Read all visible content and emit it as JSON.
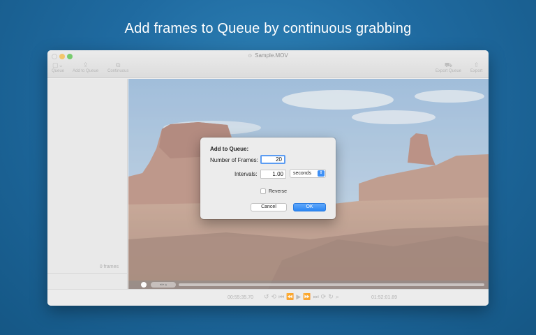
{
  "headline": "Add frames to Queue by continuous grabbing",
  "window": {
    "title": "Sample.MOV",
    "toolbar": {
      "queue": "Queue",
      "add_to_queue": "Add to Queue",
      "continuous": "Continuous",
      "export_queue": "Export Queue",
      "export": "Export"
    },
    "sidebar": {
      "frames_count": "0 frames"
    },
    "controls": {
      "current_time": "00:55:35.70",
      "total_time": "01:52:01.89"
    }
  },
  "dialog": {
    "title": "Add to Queue:",
    "frames_label": "Number of Frames:",
    "frames_value": "20",
    "intervals_label": "Intervals:",
    "intervals_value": "1.00",
    "unit_value": "seconds",
    "reverse_label": "Reverse",
    "reverse_checked": false,
    "cancel_label": "Cancel",
    "ok_label": "OK"
  },
  "colors": {
    "background": "#1f6aa0",
    "ok_button": "#2b86f3",
    "focus_ring": "#5b9cf2"
  },
  "icons": {
    "queue": "queue-icon",
    "add_to_queue": "add-to-queue-icon",
    "continuous": "continuous-icon",
    "export_queue": "export-queue-icon",
    "export": "export-icon"
  }
}
